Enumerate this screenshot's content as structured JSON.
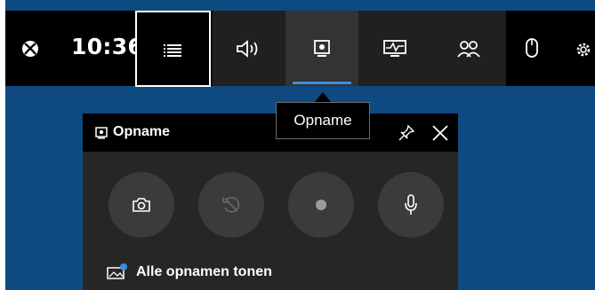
{
  "topbar": {
    "time": "10:36",
    "widgets": [
      {
        "name": "audio",
        "icon": "speaker-icon"
      },
      {
        "name": "capture",
        "icon": "capture-icon",
        "active": true
      },
      {
        "name": "performance",
        "icon": "performance-icon"
      },
      {
        "name": "social",
        "icon": "people-icon"
      }
    ],
    "extra_icons": [
      "mouse-icon",
      "gear-icon"
    ]
  },
  "tooltip": {
    "text": "Opname"
  },
  "capture_panel": {
    "title": "Opname",
    "buttons": [
      "screenshot",
      "record-last",
      "record",
      "microphone"
    ],
    "show_all_label": "Alle opnamen tonen"
  },
  "colors": {
    "desktop": "#0e4a80",
    "bar": "#000000",
    "widgets_bg": "#202020",
    "accent": "#3a8edc",
    "panel": "#262626",
    "button": "#3b3b3b"
  }
}
